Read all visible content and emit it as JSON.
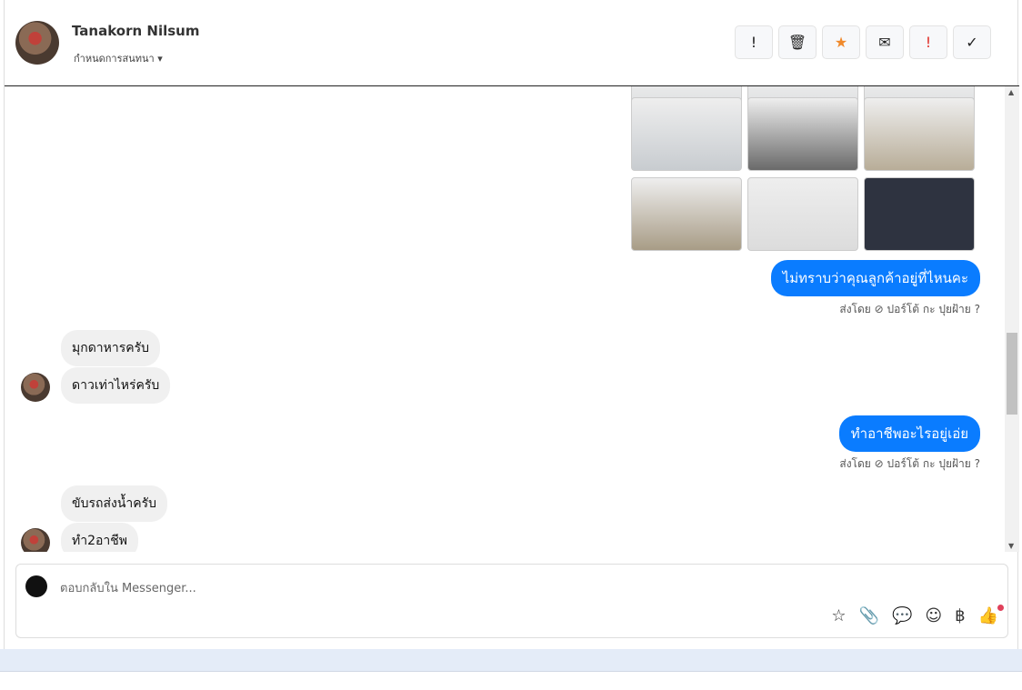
{
  "header": {
    "name": "Tanakorn Nilsum",
    "subtitle": "กำหนดการสนทนา",
    "actions": [
      {
        "name": "report-button",
        "icon": "!",
        "color": "#222"
      },
      {
        "name": "delete-button",
        "icon": "🗑",
        "color": "#222"
      },
      {
        "name": "star-button",
        "icon": "★",
        "color": "#f0892b"
      },
      {
        "name": "mark-unread-button",
        "icon": "✉",
        "color": "#222"
      },
      {
        "name": "important-button",
        "icon": "!",
        "color": "#e0302a"
      },
      {
        "name": "done-button",
        "icon": "✓",
        "color": "#222"
      }
    ]
  },
  "messages": [
    {
      "dir": "out",
      "text": "ไม่ทราบว่าคุณลูกค้าอยู่ที่ไหนคะ",
      "meta": "ส่งโดย ⊘ ปอร์โต้ กะ ปุยฝ้าย ?"
    },
    {
      "dir": "in",
      "text": "มุกดาหารครับ"
    },
    {
      "dir": "in",
      "text": "ดาวเท่าไหร่ครับ"
    },
    {
      "dir": "out",
      "text": "ทำอาชีพอะไรอยู่เอ่ย",
      "meta": "ส่งโดย ⊘ ปอร์โต้ กะ ปุยฝ้าย ?"
    },
    {
      "dir": "in",
      "text": "ขับรถส่งน้ำครับ"
    },
    {
      "dir": "in",
      "text": "ทำ2อาชีพ"
    }
  ],
  "composer": {
    "placeholder": "ตอบกลับใน Messenger...",
    "tools": [
      "☆",
      "📎",
      "💬",
      "☺",
      "฿",
      "👍"
    ]
  },
  "colors": {
    "accent": "#0a7cff"
  }
}
